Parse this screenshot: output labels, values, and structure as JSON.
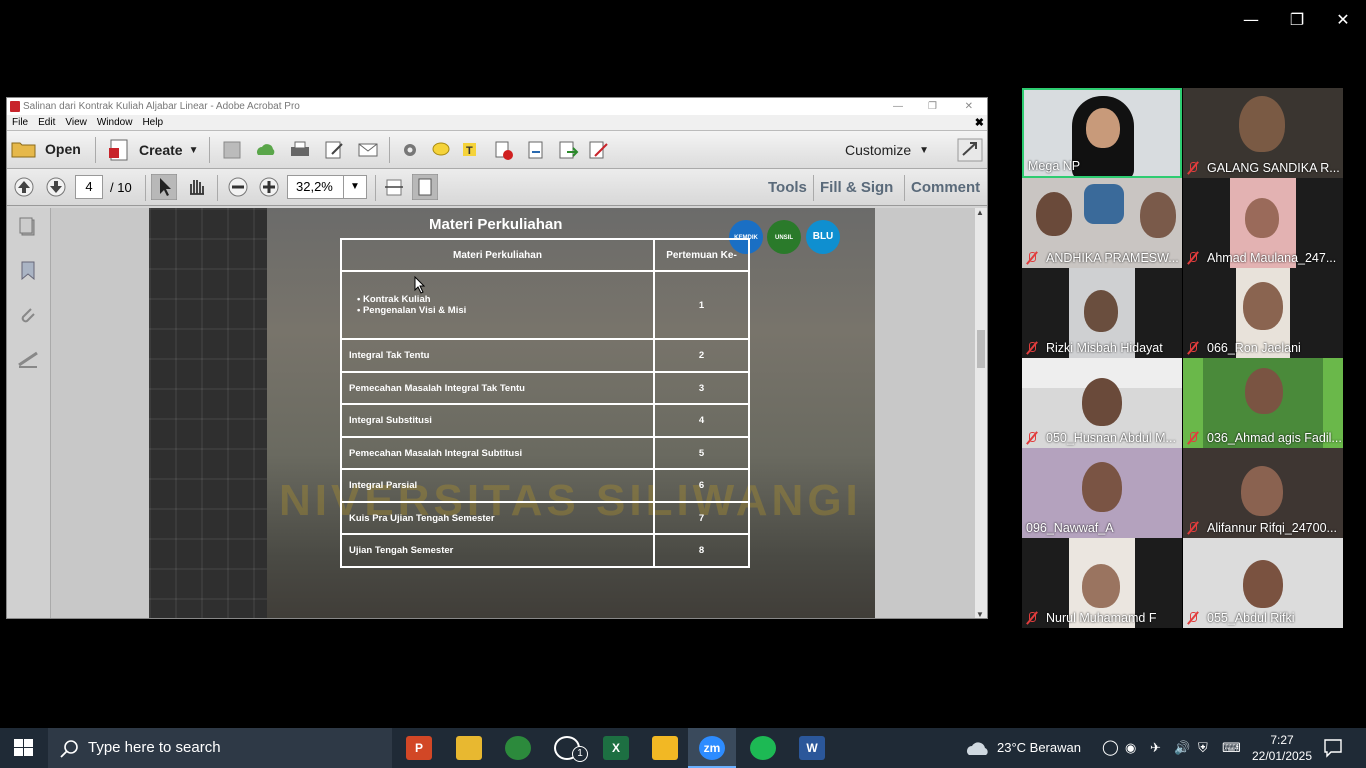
{
  "window_controls": {
    "minimize": "—",
    "restore": "❐",
    "close": "✕"
  },
  "acrobat": {
    "title": "Salinan dari Kontrak Kuliah Aljabar Linear - Adobe Acrobat Pro",
    "menu": [
      "File",
      "Edit",
      "View",
      "Window",
      "Help"
    ],
    "toolbar": {
      "open": "Open",
      "create": "Create",
      "customize": "Customize"
    },
    "nav": {
      "page_current": "4",
      "page_total": "/ 10",
      "zoom": "32,2%"
    },
    "panels": {
      "tools": "Tools",
      "fill_sign": "Fill & Sign",
      "comment": "Comment"
    }
  },
  "slide": {
    "title": "Materi Perkuliahan",
    "watermark": "NIVERSITAS SILIWANGI",
    "logos": [
      "KEMDIK",
      "UNSIL",
      "BLU"
    ],
    "table": {
      "headers": [
        "Materi Perkuliahan",
        "Pertemuan Ke-"
      ],
      "first_row_items": [
        "Kontrak Kuliah",
        "Pengenalan Visi & Misi"
      ],
      "first_row_num": "1",
      "rows": [
        {
          "label": "Integral Tak Tentu",
          "num": "2"
        },
        {
          "label": "Pemecahan Masalah Integral Tak Tentu",
          "num": "3"
        },
        {
          "label": "Integral Substitusi",
          "num": "4"
        },
        {
          "label": "Pemecahan Masalah Integral Subtitusi",
          "num": "5"
        },
        {
          "label": "Integral Parsial",
          "num": "6"
        },
        {
          "label": "Kuis Pra Ujian Tengah Semester",
          "num": "7"
        },
        {
          "label": "Ujian Tengah Semester",
          "num": "8"
        }
      ]
    }
  },
  "participants": [
    {
      "name": "Mega NP",
      "muted": false
    },
    {
      "name": "GALANG SANDIKA R...",
      "muted": true
    },
    {
      "name": "ANDHIKA PRAMESW...",
      "muted": true
    },
    {
      "name": "Ahmad Maulana_247...",
      "muted": true
    },
    {
      "name": "Rizki Misbah Hidayat",
      "muted": true
    },
    {
      "name": "066_Ron Jaelani",
      "muted": true
    },
    {
      "name": "050_Husnan Abdul M...",
      "muted": true
    },
    {
      "name": "036_Ahmad agis Fadil...",
      "muted": true
    },
    {
      "name": "096_Nawwaf_A",
      "muted": false
    },
    {
      "name": "Alifannur Rifqi_24700...",
      "muted": true
    },
    {
      "name": "Nurul Muhamamd F",
      "muted": true
    },
    {
      "name": "055_Abdul Rifki",
      "muted": true
    }
  ],
  "taskbar": {
    "search_placeholder": "Type here to search",
    "whatsapp_badge": "1",
    "weather": "23°C  Berawan",
    "time": "7:27",
    "date": "22/01/2025"
  }
}
